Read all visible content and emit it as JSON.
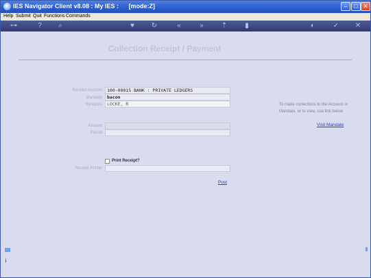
{
  "window": {
    "title": "IES Navigator Client v8.08 : My IES :",
    "mode": "[mode:Z]"
  },
  "menu": [
    "Help",
    "Submit",
    "Quit",
    "Functions",
    "Commands"
  ],
  "toolbar": {
    "icons": [
      "key-icon",
      "help-icon",
      "search-icon",
      "heart-icon",
      "refresh-icon",
      "back-icon",
      "forward-icon",
      "upload-icon",
      "document-icon",
      "globe-icon",
      "check-icon",
      "close-icon"
    ]
  },
  "page": {
    "heading": "Collection Receipt / Payment"
  },
  "form": {
    "receipt_account_label": "Receipt Account",
    "receipt_account_value": "100-00015 BANK : PRIVATE LEDGERS",
    "mandate_label": "Mandate",
    "mandate_value": "bacon",
    "synopsis_label": "Synopsis",
    "synopsis_value": "LOCKE, R",
    "amount_label": "Amount",
    "amount_value": "",
    "period_label": "Period",
    "period_value": "",
    "print_receipt_label": "Print Receipt?",
    "receipt_printer_label": "Receipt Printer",
    "receipt_printer_value": ""
  },
  "help": {
    "text": "To make corrections to the Account or Mandate, or to view, use link below",
    "view_mandate_link": "Visit Mandate"
  },
  "actions": {
    "post_link": "Post"
  }
}
